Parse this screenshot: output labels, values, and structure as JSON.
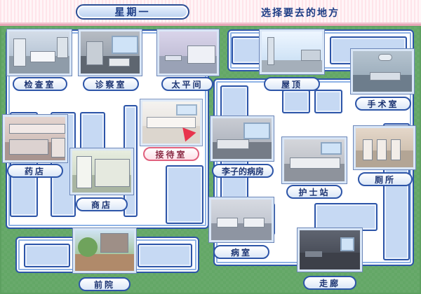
{
  "header": {
    "day": "星期一",
    "prompt": "选择要去的地方"
  },
  "locations": [
    {
      "id": "exam",
      "label": "检查室"
    },
    {
      "id": "diagnosis",
      "label": "诊察室"
    },
    {
      "id": "morgue",
      "label": "太平间"
    },
    {
      "id": "rooftop",
      "label": "屋顶"
    },
    {
      "id": "surgery",
      "label": "手术室"
    },
    {
      "id": "pharmacy",
      "label": "药店"
    },
    {
      "id": "reception",
      "label": "接待室"
    },
    {
      "id": "sumomo",
      "label": "李子的病房"
    },
    {
      "id": "toilet",
      "label": "厕所"
    },
    {
      "id": "nurse",
      "label": "护士站"
    },
    {
      "id": "shop",
      "label": "商店"
    },
    {
      "id": "ward",
      "label": "病室"
    },
    {
      "id": "front",
      "label": "前院"
    },
    {
      "id": "corridor",
      "label": "走廊"
    }
  ],
  "colors": {
    "corridor_border": "#2d55a8",
    "label_text": "#1c3472",
    "highlight": "#e0607d",
    "grass": "#63a766",
    "banner": "#ffeef2"
  },
  "selected": "reception"
}
